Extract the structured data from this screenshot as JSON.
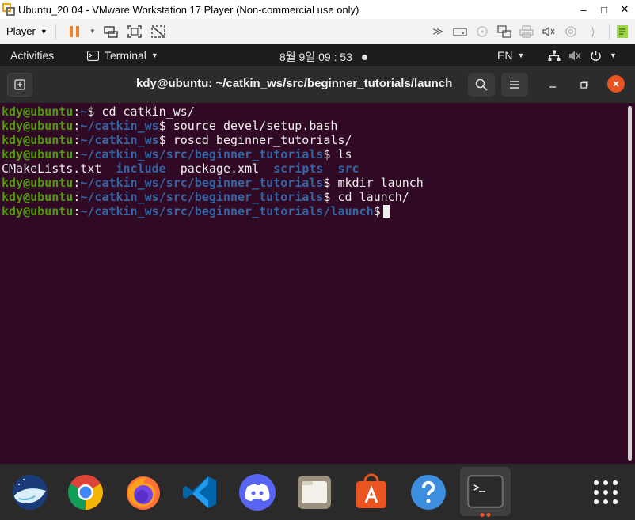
{
  "vm_window": {
    "title": "Ubuntu_20.04 - VMware Workstation 17 Player (Non-commercial use only)",
    "controls": [
      "–",
      "□",
      "✕"
    ]
  },
  "vm_toolbar": {
    "player_label": "Player"
  },
  "ubuntu_topbar": {
    "activities": "Activities",
    "app_menu": "Terminal",
    "clock": "8월 9일  09 : 53",
    "input_lang": "EN"
  },
  "terminal": {
    "window_title": "kdy@ubuntu: ~/catkin_ws/src/beginner_tutorials/launch",
    "lines": [
      {
        "user": "kdy@ubuntu",
        "sep": ":",
        "path": "~",
        "cmd": "$ cd catkin_ws/"
      },
      {
        "user": "kdy@ubuntu",
        "sep": ":",
        "path": "~/catkin_ws",
        "cmd": "$ source devel/setup.bash"
      },
      {
        "user": "kdy@ubuntu",
        "sep": ":",
        "path": "~/catkin_ws",
        "cmd": "$ roscd beginner_tutorials/"
      },
      {
        "user": "kdy@ubuntu",
        "sep": ":",
        "path": "~/catkin_ws/src/beginner_tutorials",
        "cmd": "$ ls"
      },
      {
        "ls": [
          {
            "name": "CMakeLists.txt",
            "dir": false
          },
          {
            "name": "include",
            "dir": true
          },
          {
            "name": "package.xml",
            "dir": false
          },
          {
            "name": "scripts",
            "dir": true
          },
          {
            "name": "src",
            "dir": true
          }
        ]
      },
      {
        "user": "kdy@ubuntu",
        "sep": ":",
        "path": "~/catkin_ws/src/beginner_tutorials",
        "cmd": "$ mkdir launch"
      },
      {
        "user": "kdy@ubuntu",
        "sep": ":",
        "path": "~/catkin_ws/src/beginner_tutorials",
        "cmd": "$ cd launch/"
      },
      {
        "user": "kdy@ubuntu",
        "sep": ":",
        "path": "~/catkin_ws/src/beginner_tutorials/launch",
        "cmd": "$",
        "cursor": true
      }
    ]
  },
  "dock": {
    "apps": [
      {
        "name": "Wireshark",
        "icon": "wireshark-icon"
      },
      {
        "name": "Google Chrome",
        "icon": "chrome-icon"
      },
      {
        "name": "Firefox",
        "icon": "firefox-icon"
      },
      {
        "name": "Visual Studio Code",
        "icon": "vscode-icon"
      },
      {
        "name": "Discord",
        "icon": "discord-icon"
      },
      {
        "name": "Files",
        "icon": "files-icon"
      },
      {
        "name": "Ubuntu Software",
        "icon": "software-icon"
      },
      {
        "name": "Help",
        "icon": "help-icon"
      },
      {
        "name": "Terminal",
        "icon": "terminal-icon"
      },
      {
        "name": "Show Applications",
        "icon": "app-grid-icon"
      }
    ]
  },
  "colors": {
    "terminal_bg": "#300a24",
    "prompt_user": "#4e9a06",
    "prompt_path": "#3465a4",
    "accent_orange": "#e95420"
  }
}
